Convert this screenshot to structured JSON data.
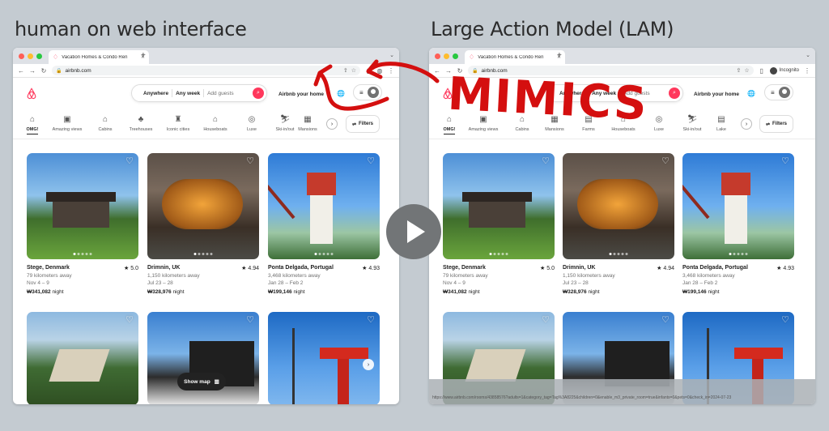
{
  "headings": {
    "left": "human on web interface",
    "right": "Large Action Model (LAM)"
  },
  "annotation": {
    "text": "MIMICS",
    "color": "#d40f0f"
  },
  "browser": {
    "tab_title": "Vacation Homes & Condo Ren",
    "url": "airbnb.com",
    "incognito_label": "Incognito"
  },
  "airbnb": {
    "brand_color": "#ff385c",
    "search": {
      "where": "Anywhere",
      "when": "Any week",
      "guests": "Add guests"
    },
    "host_label": "Airbnb your home",
    "filters_label": "Filters",
    "show_map_label": "Show map",
    "categories_left": [
      "OMG!",
      "Amazing views",
      "Cabins",
      "Treehouses",
      "Iconic cities",
      "Houseboats",
      "Luxe",
      "Ski-in/out",
      "Mansions"
    ],
    "categories_right": [
      "OMG!",
      "Amazing views",
      "Cabins",
      "Mansions",
      "Farms",
      "Houseboats",
      "Luxe",
      "Ski-in/out",
      "Lake"
    ],
    "listings": [
      {
        "title": "Stege, Denmark",
        "rating": "★ 5.0",
        "distance": "79 kilometers away",
        "dates": "Nov 4 – 9",
        "price": "₩341,082",
        "price_suffix": " night"
      },
      {
        "title": "Drimnin, UK",
        "rating": "★ 4.94",
        "distance": "1,150 kilometers away",
        "dates": "Jul 23 – 28",
        "price": "₩328,976",
        "price_suffix": " night"
      },
      {
        "title": "Ponta Delgada, Portugal",
        "rating": "★ 4.93",
        "distance": "3,468 kilometers away",
        "dates": "Jan 28 – Feb 2",
        "price": "₩199,146",
        "price_suffix": " night"
      }
    ],
    "status_url": "https://www.airbnb.com/rooms/43858576?adults=1&category_tag=Tag%3A8225&children=0&enable_m3_private_room=true&infants=0&pets=0&check_in=2024-07-23"
  }
}
